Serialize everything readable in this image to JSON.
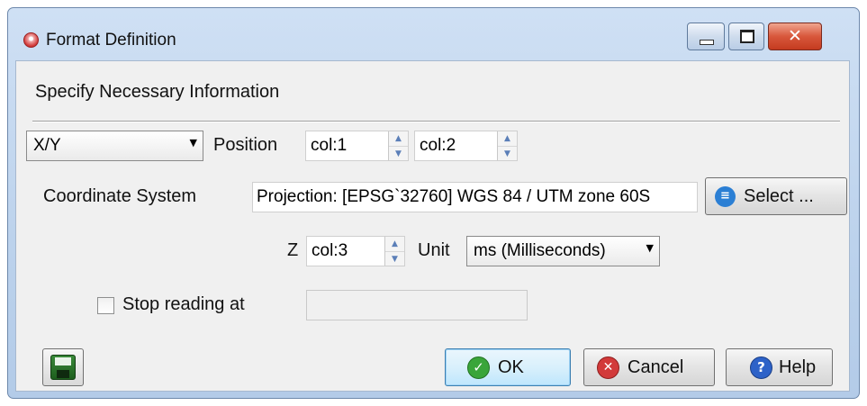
{
  "window": {
    "title": "Format Definition",
    "close_glyph": "✕"
  },
  "header": {
    "text": "Specify Necessary Information"
  },
  "position_row": {
    "mode_value": "X/Y",
    "label": "Position",
    "x_column": "col:1",
    "y_column": "col:2"
  },
  "coordinate_system": {
    "label": "Coordinate System",
    "value": "Projection: [EPSG`32760] WGS 84 / UTM zone 60S",
    "select_label": "Select ..."
  },
  "z_row": {
    "label": "Z",
    "column": "col:3",
    "unit_label": "Unit",
    "unit_value": "ms (Milliseconds)"
  },
  "stop_reading": {
    "label": "Stop reading at",
    "checked": false,
    "value": ""
  },
  "footer": {
    "ok_label": "OK",
    "cancel_label": "Cancel",
    "help_label": "Help",
    "help_glyph": "?"
  },
  "colors": {
    "title_bar": "#bcd2ec",
    "client_bg": "#f0f0f0",
    "close_button": "#c94a2d",
    "ok_icon": "#3aa53a",
    "cancel_icon": "#d23a3a",
    "help_icon": "#2d62c8",
    "select_icon": "#2b7fd4"
  },
  "icons": {
    "app": "app-logo-icon",
    "select": "list-icon",
    "ok": "checkmark-icon",
    "cancel": "x-icon",
    "help": "question-icon",
    "save": "floppy-disk-icon"
  }
}
